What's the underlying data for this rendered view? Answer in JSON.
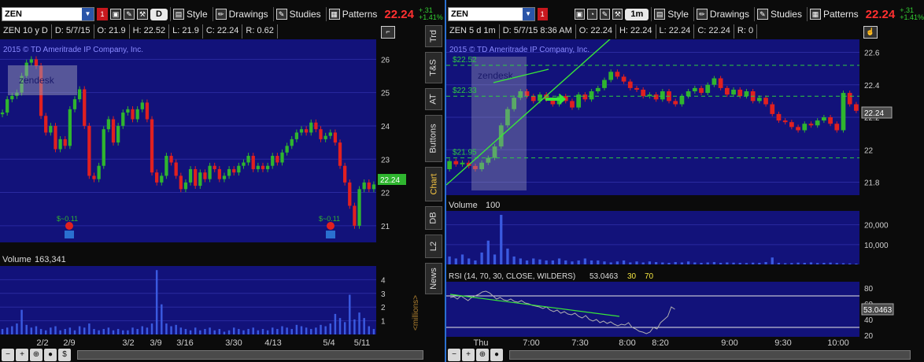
{
  "left": {
    "symbol": "ZEN",
    "agg": "D",
    "price": "22.24",
    "chg1": "+.31",
    "chg2": "+1.41%",
    "tb": {
      "style": "Style",
      "drawings": "Drawings",
      "studies": "Studies",
      "patterns": "Patterns"
    },
    "info": [
      "ZEN 10 y D",
      "D: 5/7/15",
      "O: 21.9",
      "H: 22.52",
      "L: 21.9",
      "C: 22.24",
      "R: 0.62"
    ],
    "copyright": "2015 © TD Ameritrade IP Company, Inc.",
    "watermark": "zendesk",
    "priceLabel": "22.24",
    "divLabel1": "$~0.11",
    "divLabel2": "$~0.11",
    "volLabel": "Volume",
    "volValue": "163,341",
    "millions": "<millions>"
  },
  "right": {
    "symbol": "ZEN",
    "agg": "1m",
    "price": "22.24",
    "chg1": "+.31",
    "chg2": "+1.41%",
    "tb": {
      "style": "Style",
      "drawings": "Drawings",
      "studies": "Studies",
      "patterns": "Patterns"
    },
    "info": [
      "ZEN 5 d 1m",
      "D: 5/7/15 8:36 AM",
      "O: 22.24",
      "H: 22.24",
      "L: 22.24",
      "C: 22.24",
      "R: 0"
    ],
    "copyright": "2015 © TD Ameritrade IP Company, Inc.",
    "watermark": "zendesk",
    "priceLabel": "22.24",
    "volLabel": "Volume",
    "volValue": "100",
    "rsiLabel": "RSI (14, 70, 30, CLOSE, WILDERS)",
    "rsiValue": "53.0463",
    "rsiOver": "30",
    "rsiUnder": "70",
    "rsiBox": "53.0463",
    "levels": [
      "$22.52",
      "$22.33",
      "$21.95"
    ]
  },
  "sideTabs": [
    "Trd",
    "T&S",
    "AT",
    "Buttons",
    "Chart",
    "DB",
    "L2",
    "News"
  ],
  "bottomLeft": [
    "−",
    "+",
    "⊕",
    "●",
    "$"
  ],
  "bottomRight": [
    "−",
    "+",
    "⊕",
    "●"
  ],
  "colors": {
    "bg": "#0b0b0b",
    "plot": "#12127a",
    "up": "#2fb52f",
    "down": "#e02020",
    "grid": "#2a2aa0",
    "vol": "#3a5ae0",
    "rsi": "#b0b0b0",
    "trend": "#39e639",
    "level": "#2ecc40"
  },
  "chart_data": [
    {
      "type": "candlestick",
      "title": "ZEN 10 y D",
      "xticks": [
        "2/2",
        "2/9",
        "3/2",
        "3/9",
        "3/16",
        "3/30",
        "4/13",
        "5/4",
        "5/11"
      ],
      "yticks": [
        21,
        22,
        23,
        24,
        25,
        26
      ],
      "ylim": [
        20.5,
        26.6
      ],
      "grid": true,
      "closes": [
        24.4,
        24.8,
        24.9,
        25.0,
        25.5,
        25.9,
        26.0,
        25.8,
        24.3,
        23.8,
        24.0,
        23.3,
        23.6,
        23.4,
        24.5,
        24.8,
        25.1,
        24.0,
        22.5,
        22.4,
        22.8,
        23.9,
        24.2,
        23.5,
        24.0,
        24.4,
        24.5,
        24.2,
        24.5,
        24.7,
        24.2,
        22.6,
        22.3,
        22.5,
        23.1,
        22.9,
        22.5,
        22.1,
        22.3,
        22.7,
        22.2,
        22.6,
        22.4,
        22.8,
        22.7,
        22.4,
        22.5,
        22.7,
        22.6,
        22.8,
        22.9,
        23.1,
        22.7,
        22.8,
        22.7,
        22.8,
        23.1,
        22.9,
        23.2,
        23.4,
        23.6,
        23.8,
        23.9,
        23.8,
        24.1,
        23.9,
        23.6,
        23.7,
        23.8,
        23.5,
        22.8,
        22.3,
        21.6,
        21.0,
        22.1,
        22.3,
        22.1,
        22.24
      ]
    },
    {
      "type": "bar",
      "title": "Volume",
      "yticks": [
        1,
        2,
        3,
        4
      ],
      "ylabel": "<millions>",
      "values": [
        0.4,
        0.5,
        0.6,
        0.8,
        1.8,
        0.7,
        0.5,
        0.6,
        0.4,
        0.3,
        0.5,
        0.6,
        0.3,
        0.4,
        0.5,
        0.3,
        0.6,
        0.5,
        0.8,
        0.4,
        0.3,
        0.4,
        0.5,
        0.3,
        0.4,
        0.3,
        0.3,
        0.5,
        0.4,
        0.6,
        0.5,
        0.8,
        4.7,
        2.2,
        0.8,
        0.6,
        0.7,
        0.5,
        0.4,
        0.3,
        0.5,
        0.3,
        0.4,
        0.5,
        0.3,
        0.4,
        0.2,
        0.3,
        0.5,
        0.4,
        0.3,
        0.4,
        0.5,
        0.3,
        0.4,
        0.3,
        0.5,
        0.4,
        0.6,
        0.5,
        0.4,
        0.7,
        0.6,
        0.5,
        0.4,
        0.5,
        0.7,
        0.6,
        0.8,
        1.5,
        1.2,
        0.9,
        2.9,
        1.1,
        1.6,
        1.2,
        0.6,
        0.4
      ]
    },
    {
      "type": "candlestick",
      "title": "ZEN 5 d 1m",
      "xticks": [
        "Thu",
        "7:00",
        "7:30",
        "8:00",
        "8:20",
        "9:00",
        "9:30",
        "10:00"
      ],
      "yticks": [
        21.8,
        22,
        22.2,
        22.4,
        22.6
      ],
      "ylim": [
        21.72,
        22.68
      ],
      "grid": true,
      "closes": [
        21.93,
        21.91,
        21.92,
        21.9,
        21.88,
        21.92,
        21.95,
        22.02,
        22.15,
        22.25,
        22.32,
        22.36,
        22.33,
        22.3,
        22.34,
        22.31,
        22.28,
        22.33,
        22.3,
        22.26,
        22.34,
        22.31,
        22.36,
        22.38,
        22.43,
        22.48,
        22.45,
        22.42,
        22.38,
        22.37,
        22.33,
        22.34,
        22.31,
        22.36,
        22.3,
        22.28,
        22.33,
        22.36,
        22.38,
        22.35,
        22.4,
        22.44,
        22.38,
        22.34,
        22.37,
        22.33,
        22.36,
        22.3,
        22.32,
        22.28,
        22.22,
        22.18,
        22.17,
        22.14,
        22.12,
        22.16,
        22.15,
        22.18,
        22.2,
        22.16,
        22.12,
        22.35,
        22.28,
        22.24
      ],
      "levels": [
        22.52,
        22.33,
        21.95
      ]
    },
    {
      "type": "bar",
      "title": "Volume",
      "yticks": [
        10000,
        20000
      ],
      "values": [
        4000,
        3000,
        5000,
        3000,
        2000,
        6000,
        12000,
        5000,
        25000,
        8000,
        4000,
        3000,
        2000,
        3000,
        2500,
        2000,
        2000,
        3000,
        2000,
        1500,
        2000,
        3000,
        2000,
        2000,
        1500,
        1000,
        1500,
        2000,
        1000,
        1500,
        1000,
        1500,
        1200,
        1000,
        800,
        1200,
        1000,
        1500,
        1000,
        800,
        1000,
        1200,
        800,
        1000,
        900,
        800,
        700,
        900,
        800,
        1200,
        3500,
        800,
        600,
        700,
        900,
        800,
        1000,
        700,
        800,
        900,
        700,
        600,
        500,
        400
      ]
    },
    {
      "type": "line",
      "title": "RSI (14, 70, 30, CLOSE, WILDERS)",
      "yticks": [
        20,
        40,
        60,
        80
      ],
      "ylim": [
        18,
        88
      ],
      "values": [
        68,
        69,
        66,
        70,
        67,
        64,
        68,
        70,
        72,
        75,
        76,
        74,
        70,
        66,
        68,
        65,
        64,
        66,
        63,
        62,
        64,
        61,
        60,
        58,
        57,
        56,
        54,
        56,
        52,
        50,
        52,
        48,
        50,
        47,
        46,
        48,
        44,
        42,
        45,
        40,
        38,
        40,
        36,
        38,
        35,
        37,
        34,
        32,
        34,
        33,
        36,
        30,
        28,
        25,
        24,
        22,
        24,
        30,
        28,
        36,
        40,
        44,
        56,
        53
      ]
    }
  ]
}
